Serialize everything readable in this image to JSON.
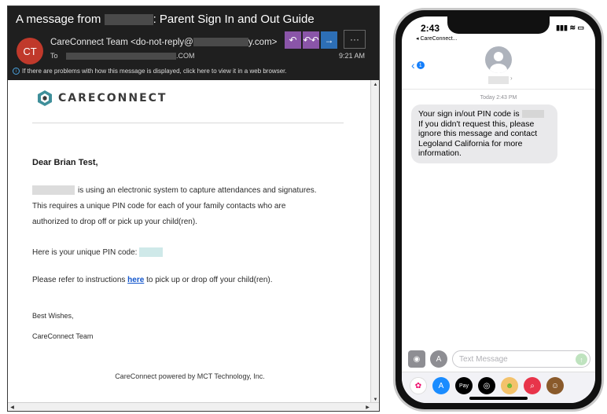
{
  "email": {
    "subject_prefix": "A message from",
    "subject_suffix": ": Parent Sign In and Out Guide",
    "avatar_initials": "CT",
    "sender_prefix": "CareConnect Team <do-not-reply@",
    "sender_suffix": "y.com>",
    "to_label": "To",
    "to_suffix": ".COM",
    "time": "9:21 AM",
    "info_bar": "If there are problems with how this message is displayed, click here to view it in a web browser.",
    "info_icon": "info-icon",
    "more_label": "···",
    "actions": {
      "reply": "↶",
      "reply_all": "↶↶",
      "forward": "→"
    },
    "body": {
      "logo_text": "CARECONNECT",
      "greeting": "Dear Brian Test,",
      "para1_line1": "is using an electronic system to capture attendances and signatures.",
      "para1_line2": "This requires a unique PIN code for each of your family contacts who are",
      "para1_line3": "authorized to drop off or pick up your child(ren).",
      "pin_label": "Here is your unique PIN code:",
      "instructions_prefix": "Please refer to instructions",
      "instructions_link": "here",
      "instructions_suffix": "to pick up or drop off your child(ren).",
      "closing": "Best Wishes,",
      "signature": "CareConnect Team",
      "footer": "CareConnect powered by MCT Technology, Inc."
    }
  },
  "phone": {
    "status_time": "2:43",
    "back_app": "◂ CareConnect...",
    "status_icons": "▮▮▮ ≋ ▭",
    "back_badge": "1",
    "timestamp": "Today 2:43 PM",
    "message_prefix": "Your sign in/out PIN code is",
    "message_rest": "If you didn't request this, please ignore this message and contact Legoland California for more information.",
    "input_placeholder": "Text Message",
    "tray_icons": [
      "photos-icon",
      "app-store-icon",
      "apple-pay-icon",
      "activity-icon",
      "memoji-icon",
      "search-images-icon",
      "animoji-icon"
    ]
  }
}
